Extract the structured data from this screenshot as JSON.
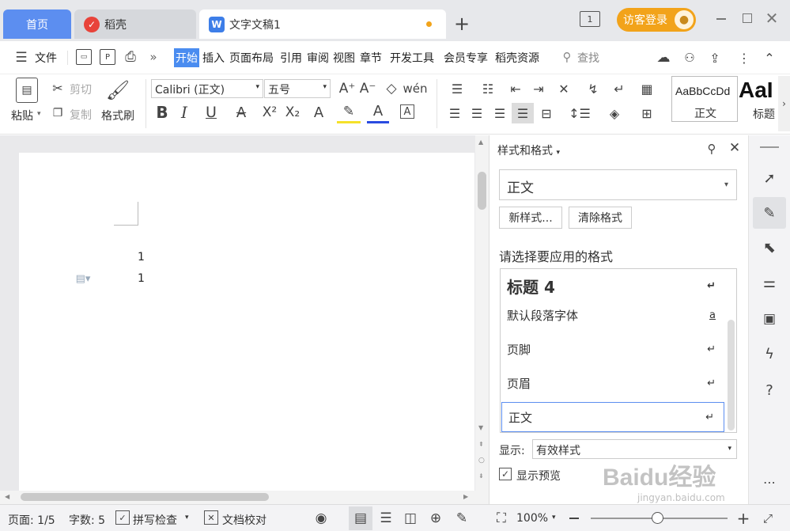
{
  "tabs": {
    "home": "首页",
    "daoke": "稻壳",
    "document": "文字文稿1",
    "new_tab": "+",
    "login": "访客登录"
  },
  "menu": {
    "file": "文件",
    "items": [
      "开始",
      "插入",
      "页面布局",
      "引用",
      "审阅",
      "视图",
      "章节",
      "开发工具",
      "会员专享",
      "稻壳资源"
    ],
    "search": "查找"
  },
  "ribbon": {
    "paste": "粘贴",
    "cut": "剪切",
    "copy": "复制",
    "format_painter": "格式刷",
    "font_name": "Calibri (正文)",
    "font_size": "五号",
    "style_preview_1": "AaBbCcDd",
    "style_label_1": "正文",
    "style_preview_2": "AaI",
    "style_label_2": "标题"
  },
  "document": {
    "line1": "1",
    "line2": "1"
  },
  "pane": {
    "title": "样式和格式",
    "current_style": "正文",
    "new_style": "新样式...",
    "clear_format": "清除格式",
    "prompt": "请选择要应用的格式",
    "styles": [
      {
        "name": "标题  4",
        "mark": "↵"
      },
      {
        "name": "默认段落字体",
        "mark": "a"
      },
      {
        "name": "页脚",
        "mark": "↵"
      },
      {
        "name": "页眉",
        "mark": "↵"
      },
      {
        "name": "正文",
        "mark": "↵"
      }
    ],
    "display_label": "显示:",
    "display_value": "有效样式",
    "show_preview": "显示预览"
  },
  "status": {
    "page": "页面: 1/5",
    "word_count": "字数: 5",
    "spell_check": "拼写检查",
    "proofread": "文档校对",
    "zoom": "100%"
  },
  "watermark": {
    "text": "Baidu经验",
    "url": "jingyan.baidu.com"
  },
  "colors": {
    "accent": "#5c8ef0",
    "login_bg": "#f2a31a",
    "active_menu": "#4a8cf0"
  }
}
